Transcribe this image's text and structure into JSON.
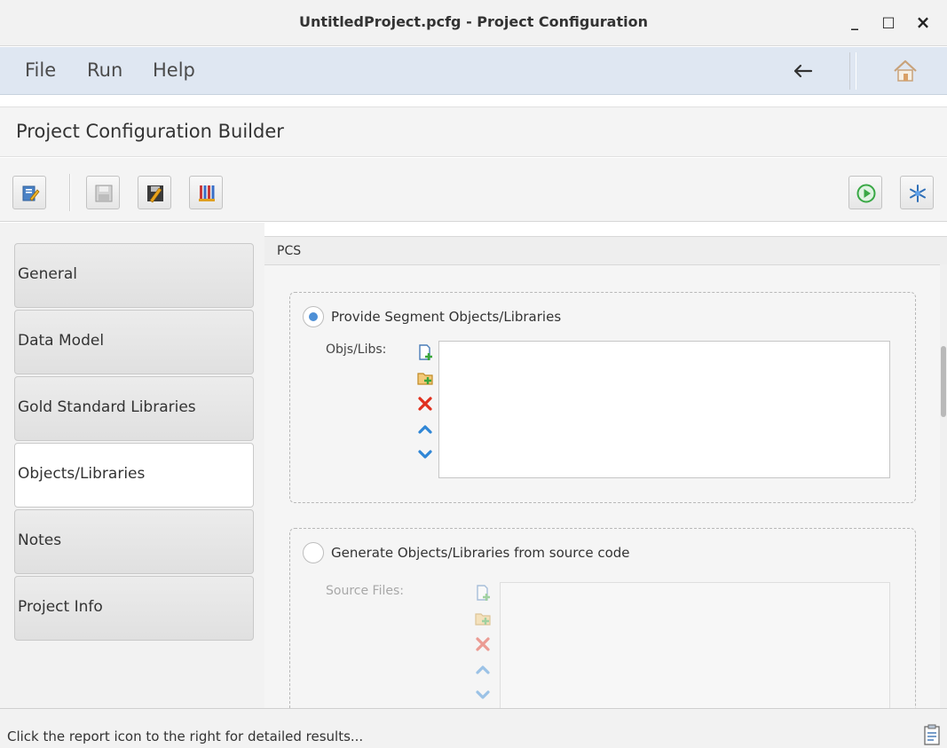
{
  "window": {
    "title": "UntitledProject.pcfg - Project Configuration",
    "minimize": "_",
    "maximize": "□",
    "close": "×"
  },
  "menubar": {
    "items": [
      "File",
      "Run",
      "Help"
    ],
    "back_icon": "arrow-left-icon",
    "home_icon": "home-icon"
  },
  "app": {
    "title": "Project Configuration Builder"
  },
  "toolbar": {
    "left_icons": [
      "edit-clipboard-icon",
      "save-icon",
      "save-as-icon",
      "binary-icon"
    ],
    "right_icons": [
      "run-icon",
      "freeze-icon"
    ]
  },
  "sidebar": {
    "tabs": [
      "General",
      "Data Model",
      "Gold Standard Libraries",
      "Objects/Libraries",
      "Notes",
      "Project Info"
    ],
    "active_index": 3
  },
  "content": {
    "header": "PCS",
    "group1": {
      "option_label": "Provide Segment Objects/Libraries",
      "selected": true,
      "field_label": "Objs/Libs:"
    },
    "group2": {
      "option_label": "Generate Objects/Libraries from source code",
      "selected": false,
      "field_label": "Source Files:"
    },
    "list_actions": [
      "add-file-icon",
      "add-folder-icon",
      "remove-icon",
      "move-up-icon",
      "move-down-icon"
    ]
  },
  "status": {
    "message": "Click the report icon to the right for detailed results...",
    "report_icon": "report-icon"
  },
  "colors": {
    "menubar_bg": "#dfe7f2",
    "radio_selected": "#4d8fd6",
    "remove_red": "#e0301e",
    "arrow_blue": "#2f86d6",
    "add_green": "#3aa63a",
    "run_green": "#39a845"
  }
}
